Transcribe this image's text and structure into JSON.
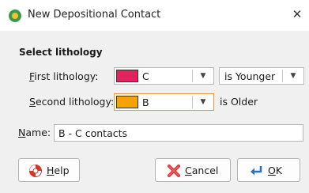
{
  "window": {
    "title": "New Depositional Contact",
    "close_glyph": "✕",
    "app_icon": "leapfrog-app-icon"
  },
  "section": {
    "label": "Select lithology"
  },
  "first": {
    "label_prefix": "F",
    "label_rest": "irst lithology:",
    "value": "C",
    "swatch_color": "#e0245e",
    "relation": "is Younger"
  },
  "second": {
    "label_prefix": "S",
    "label_rest": "econd lithology:",
    "value": "B",
    "swatch_color": "#f5a300",
    "relation": "is Older"
  },
  "name": {
    "label_prefix": "N",
    "label_rest": "ame:",
    "value": "B - C contacts"
  },
  "buttons": {
    "help": {
      "prefix": "H",
      "rest": "elp"
    },
    "cancel": {
      "prefix": "C",
      "rest": "ancel"
    },
    "ok": {
      "prefix": "O",
      "rest": "K"
    }
  },
  "icons": {
    "dropdown": "▼"
  }
}
